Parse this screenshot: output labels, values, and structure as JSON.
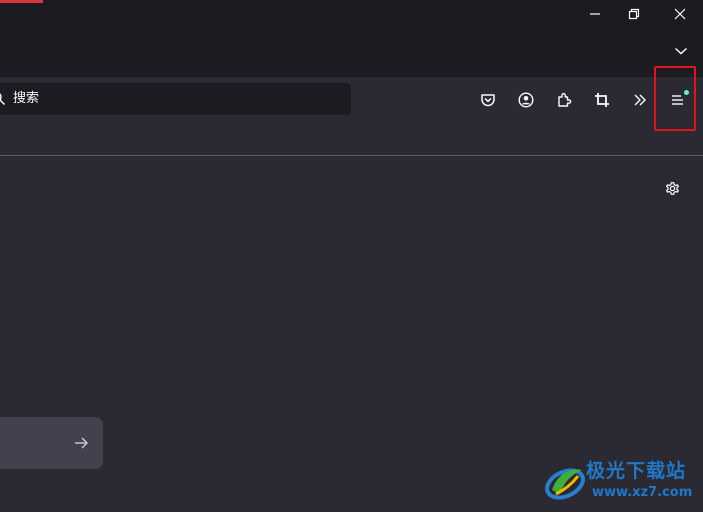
{
  "titlebar": {
    "controls": [
      "minimize-icon",
      "restore-icon",
      "close-icon",
      "list-all-tabs-icon"
    ]
  },
  "navbar": {
    "search": {
      "placeholder": "搜索"
    },
    "toolbar_icons": [
      "pocket-icon",
      "account-icon",
      "extensions-icon",
      "screenshot-icon",
      "overflow-chevron-icon",
      "app-menu-icon"
    ],
    "menu_badge_color": "#54ffbd"
  },
  "content": {
    "settings_icon": "gear-icon",
    "go_icon": "arrow-right-icon"
  },
  "colors": {
    "titlebar_bg": "#1c1b22",
    "toolbar_bg": "#2b2a33",
    "urlbar_bg": "#1c1b22",
    "icon_color": "#fbfbfe",
    "highlight_border": "#e0161b"
  },
  "watermark": {
    "name": "极光下载站",
    "url": "www.xz7.com"
  }
}
